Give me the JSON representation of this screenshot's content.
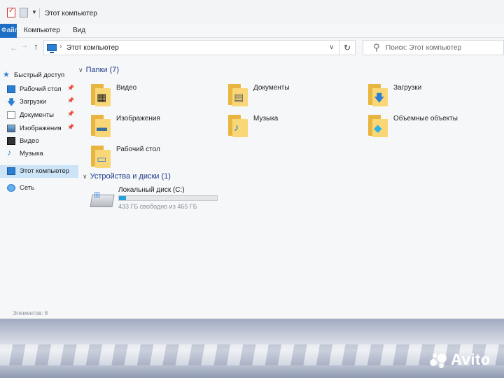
{
  "window": {
    "title": "Этот компьютер"
  },
  "ribbon": {
    "file_tab": "Файл",
    "tabs": [
      "Компьютер",
      "Вид"
    ]
  },
  "address": {
    "path": "Этот компьютер",
    "search_placeholder": "Поиск: Этот компьютер"
  },
  "sidebar": {
    "items": [
      {
        "label": "Быстрый доступ",
        "icon": "star-icon",
        "pinned": false
      },
      {
        "label": "Рабочий стол",
        "icon": "desktop-icon",
        "pinned": true
      },
      {
        "label": "Загрузки",
        "icon": "downloads-icon",
        "pinned": true
      },
      {
        "label": "Документы",
        "icon": "documents-icon",
        "pinned": true
      },
      {
        "label": "Изображения",
        "icon": "pictures-icon",
        "pinned": true
      },
      {
        "label": "Видео",
        "icon": "video-icon",
        "pinned": false
      },
      {
        "label": "Музыка",
        "icon": "music-icon",
        "pinned": false
      },
      {
        "label": "Этот компьютер",
        "icon": "this-pc-icon",
        "pinned": false,
        "selected": true
      },
      {
        "label": "Сеть",
        "icon": "network-icon",
        "pinned": false
      }
    ]
  },
  "folders_group": {
    "header": "Папки (7)",
    "items": [
      {
        "name": "Видео",
        "icon": "video-folder-icon"
      },
      {
        "name": "Документы",
        "icon": "documents-folder-icon"
      },
      {
        "name": "Загрузки",
        "icon": "downloads-folder-icon"
      },
      {
        "name": "Изображения",
        "icon": "pictures-folder-icon"
      },
      {
        "name": "Музыка",
        "icon": "music-folder-icon"
      },
      {
        "name": "Объемные объекты",
        "icon": "3d-objects-folder-icon"
      },
      {
        "name": "Рабочий стол",
        "icon": "desktop-folder-icon"
      }
    ]
  },
  "devices_group": {
    "header": "Устройства и диски (1)",
    "drive": {
      "name": "Локальный диск (C:)",
      "free_text": "433 ГБ свободно из 465 ГБ",
      "used_fraction": 0.07
    }
  },
  "status_bar": {
    "text": "Элементов: 8"
  },
  "watermark": {
    "text": "Avito"
  },
  "colors": {
    "accent": "#1c6fc5",
    "folder": "#f9d776",
    "selection": "#cce4f7",
    "progress": "#26a0da"
  }
}
